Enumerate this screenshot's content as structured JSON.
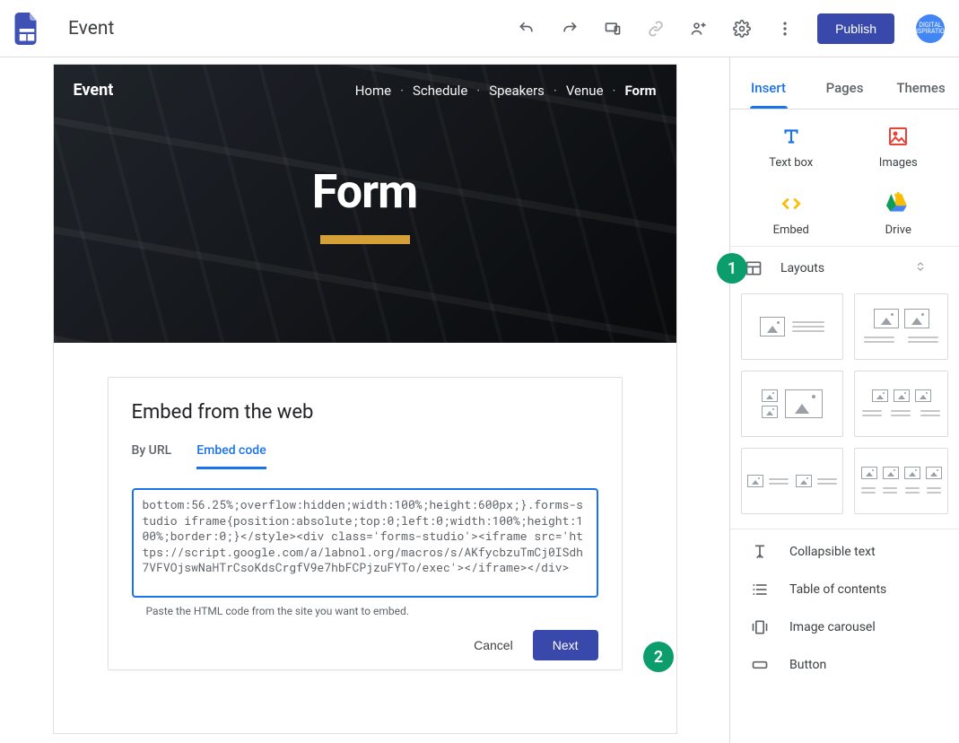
{
  "doc_title": "Event",
  "topbar": {
    "publish_label": "Publish",
    "avatar_text": "DIGITAL INSPIRATION"
  },
  "site": {
    "title": "Event",
    "nav": [
      "Home",
      "Schedule",
      "Speakers",
      "Venue",
      "Form"
    ],
    "active_nav": "Form",
    "hero_title": "Form"
  },
  "embed_dialog": {
    "title": "Embed from the web",
    "tabs": {
      "by_url": "By URL",
      "embed_code": "Embed code"
    },
    "active_tab": "embed_code",
    "code": "bottom:56.25%;overflow:hidden;width:100%;height:600px;}.forms-studio iframe{position:absolute;top:0;left:0;width:100%;height:100%;border:0;}</style><div class='forms-studio'><iframe src='https://script.google.com/a/labnol.org/macros/s/AKfycbzuTmCj0ISdh7VFVOjswNaHTrCsoKdsCrgfV9e7hbFCPjzuFYTo/exec'></iframe></div>",
    "hint": "Paste the HTML code from the site you want to embed.",
    "cancel_label": "Cancel",
    "next_label": "Next"
  },
  "annotations": {
    "badge1": "1",
    "badge2": "2"
  },
  "sidebar": {
    "tabs": {
      "insert": "Insert",
      "pages": "Pages",
      "themes": "Themes"
    },
    "active_tab": "insert",
    "insert": {
      "text_box": "Text box",
      "images": "Images",
      "embed": "Embed",
      "drive": "Drive"
    },
    "layouts_section_label": "Layouts",
    "features": {
      "collapsible": "Collapsible text",
      "toc": "Table of contents",
      "carousel": "Image carousel",
      "button": "Button"
    }
  }
}
